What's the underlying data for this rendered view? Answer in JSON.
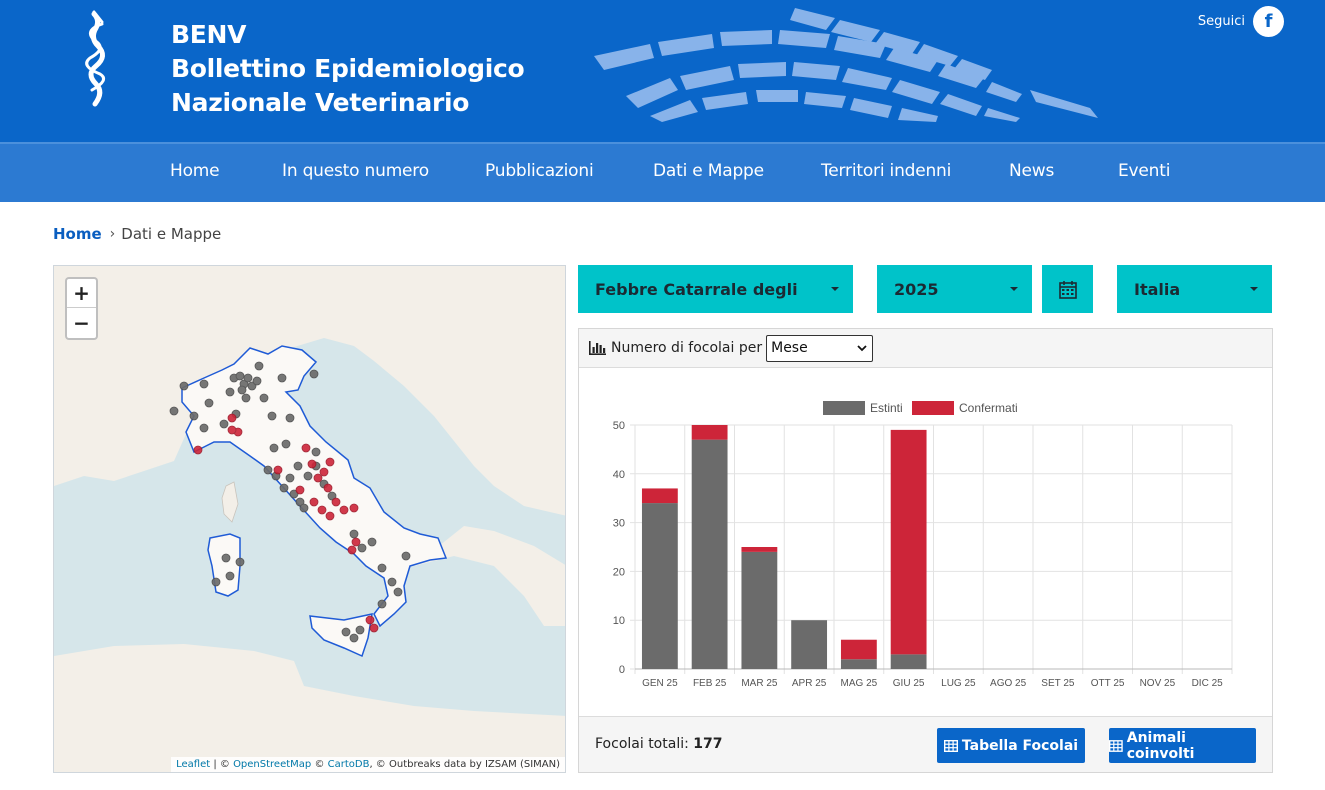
{
  "header": {
    "brand_line1": "BENV",
    "brand_line2": "Bollettino Epidemiologico",
    "brand_line3": "Nazionale Veterinario",
    "social_label": "Seguici",
    "facebook_glyph": "f"
  },
  "nav": [
    "Home",
    "In questo numero",
    "Pubblicazioni",
    "Dati e Mappe",
    "Territori indenni",
    "News",
    "Eventi"
  ],
  "breadcrumb": {
    "home": "Home",
    "current": "Dati e Mappe"
  },
  "map": {
    "zoom_in": "+",
    "zoom_out": "−",
    "attribution": {
      "leaflet": "Leaflet",
      "sep1": " | © ",
      "osm": "OpenStreetMap",
      "sep2": " © ",
      "carto": "CartoDB",
      "rest": ", © Outbreaks data by IZSAM (SIMAN)"
    },
    "colors": {
      "sea": "#d6e6ea",
      "land": "#f3efe8",
      "italy": "#fbf9f6",
      "border": "#1f5bd6",
      "extinct": "#6b6b6b",
      "confirmed": "#cd2539"
    }
  },
  "filters": {
    "disease": "Febbre Catarrale degli ovini (Blue Tongue)",
    "year": "2025",
    "area": "Italia",
    "calendar_icon": "calendar-icon"
  },
  "chart_panel": {
    "heading": "Numero di focolai per",
    "period_select": "Mese",
    "footer_total_label": "Focolai totali:",
    "footer_total_value": "177",
    "btn_table": "Tabella Focolai",
    "btn_animals": "Animali coinvolti"
  },
  "chart_data": {
    "type": "bar",
    "stacked": true,
    "categories": [
      "GEN 25",
      "FEB 25",
      "MAR 25",
      "APR 25",
      "MAG 25",
      "GIU 25",
      "LUG 25",
      "AGO 25",
      "SET 25",
      "OTT 25",
      "NOV 25",
      "DIC 25"
    ],
    "series": [
      {
        "name": "Estinti",
        "color": "#6b6b6b",
        "values": [
          34,
          47,
          24,
          10,
          2,
          3,
          0,
          0,
          0,
          0,
          0,
          0
        ]
      },
      {
        "name": "Confermati",
        "color": "#cd2539",
        "values": [
          3,
          3,
          1,
          0,
          4,
          46,
          0,
          0,
          0,
          0,
          0,
          0
        ]
      }
    ],
    "ylim": [
      0,
      50
    ],
    "yticks": [
      "0",
      "10",
      "20",
      "30",
      "40",
      "50"
    ],
    "grid": true,
    "legend": "top-center"
  }
}
